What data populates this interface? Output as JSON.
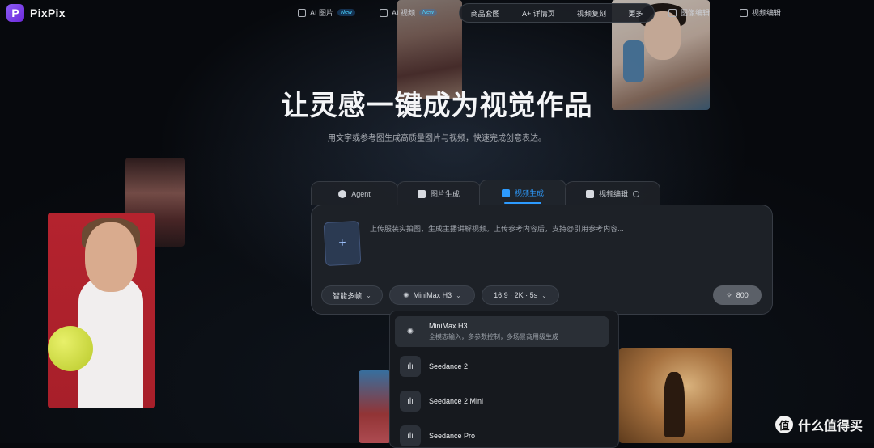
{
  "app": {
    "logo_letter": "P",
    "name": "PixPix"
  },
  "nav": {
    "items": [
      {
        "label": "AI 图片",
        "badge": "New"
      },
      {
        "label": "AI 视频",
        "badge": "New"
      }
    ],
    "pill": [
      "商品套图",
      "A+ 详情页",
      "视频复刻",
      "更多"
    ],
    "right": [
      {
        "label": "图像编辑"
      },
      {
        "label": "视频编辑"
      }
    ]
  },
  "hero": {
    "title": "让灵感一键成为视觉作品",
    "subtitle": "用文字或参考图生成高质量图片与视频，快速完成创意表达。"
  },
  "tabs": [
    {
      "label": "Agent",
      "icon": "agent-icon"
    },
    {
      "label": "图片生成",
      "icon": "image-icon"
    },
    {
      "label": "视频生成",
      "icon": "video-icon",
      "active": true
    },
    {
      "label": "视频编辑",
      "icon": "video-edit-icon"
    }
  ],
  "editor": {
    "upload_symbol": "+",
    "placeholder": "上传服装实拍图，生成主播讲解视频。上传参考内容后，支持@引用参考内容...",
    "options": {
      "frames": "智能多帧",
      "model": "MiniMax H3",
      "spec": "16:9 · 2K · 5s"
    },
    "credits": "800"
  },
  "dropdown": {
    "items": [
      {
        "name": "MiniMax H3",
        "desc": "全模态输入，多参数控制，多场景商用级生成",
        "selected": true
      },
      {
        "name": "Seedance 2"
      },
      {
        "name": "Seedance 2 Mini"
      },
      {
        "name": "Seedance Pro"
      }
    ]
  },
  "watermark": {
    "symbol": "值",
    "text": "什么值得买"
  },
  "colors": {
    "accent": "#2d9bff",
    "brand": "#7c3aed",
    "background": "#07090d"
  }
}
